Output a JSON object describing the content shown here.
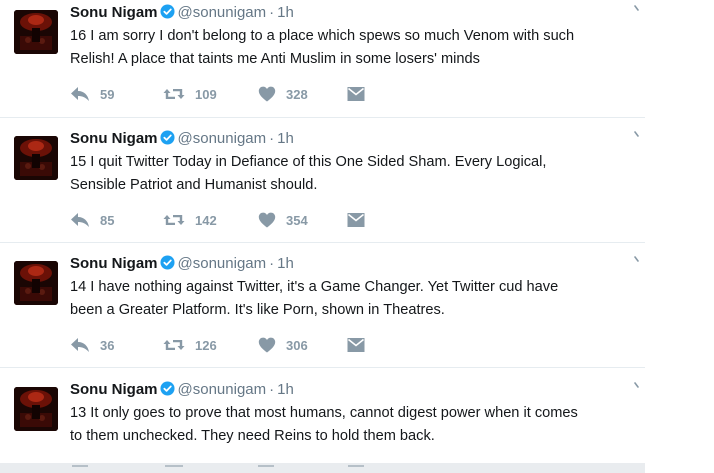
{
  "tweets": [
    {
      "name": "Sonu Nigam",
      "handle": "@sonunigam",
      "separator": "·",
      "time": "1h",
      "lines": [
        "16 I am sorry I don't belong to a place which spews so much Venom with such",
        "Relish! A place that taints me Anti Muslim in some losers' minds"
      ],
      "replies": "59",
      "retweets": "109",
      "likes": "328"
    },
    {
      "name": "Sonu Nigam",
      "handle": "@sonunigam",
      "separator": "·",
      "time": "1h",
      "lines": [
        "15 I quit Twitter Today in Defiance of this One Sided Sham. Every Logical,",
        "Sensible Patriot and Humanist should."
      ],
      "replies": "85",
      "retweets": "142",
      "likes": "354"
    },
    {
      "name": "Sonu Nigam",
      "handle": "@sonunigam",
      "separator": "·",
      "time": "1h",
      "lines": [
        "14 I have nothing against Twitter, it's a Game Changer. Yet Twitter cud have",
        "been a Greater Platform. It's like Porn, shown in Theatres."
      ],
      "replies": "36",
      "retweets": "126",
      "likes": "306"
    },
    {
      "name": "Sonu Nigam",
      "handle": "@sonunigam",
      "separator": "·",
      "time": "1h",
      "lines": [
        "13 It only goes to prove that most humans, cannot digest power when it comes",
        "to them unchecked. They need Reins to hold them back."
      ]
    }
  ],
  "icons": {
    "reply": "reply-icon",
    "retweet": "retweet-icon",
    "like": "heart-icon",
    "message": "direct-message-icon",
    "verified": "verified-badge-icon",
    "more": "chevron-down-icon"
  },
  "colors": {
    "verified": "#1da1f2",
    "action_grey": "#8899a6",
    "meta_grey": "#657786",
    "text": "#14171a"
  }
}
